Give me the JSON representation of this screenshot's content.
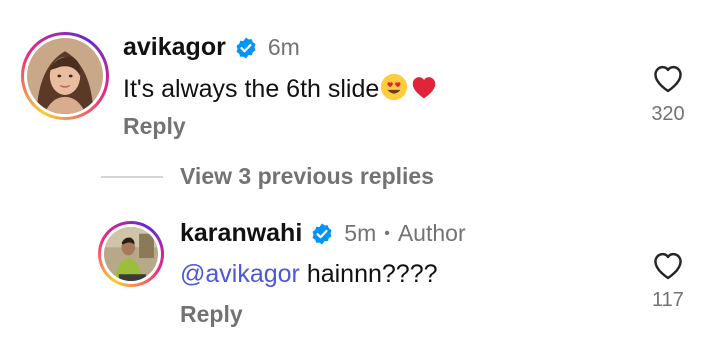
{
  "comment": {
    "username": "avikagor",
    "time": "6m",
    "text": "It's always the 6th slide",
    "reply_label": "Reply",
    "like_count": "320"
  },
  "view_replies_label": "View 3 previous replies",
  "reply": {
    "username": "karanwahi",
    "time": "5m",
    "separator": "•",
    "author_label": "Author",
    "mention": "@avikagor",
    "text": " hainnn????",
    "reply_label": "Reply",
    "like_count": "117"
  },
  "colors": {
    "verified_badge": "#0095f6",
    "heart_emoji": "#e0243a",
    "mention": "#4b59d6",
    "secondary_text": "#737373"
  },
  "icons": {
    "verified": "verified-badge-icon",
    "like": "heart-outline-icon",
    "emoji_1": "heart-eyes-emoji",
    "emoji_2": "red-heart-emoji"
  }
}
